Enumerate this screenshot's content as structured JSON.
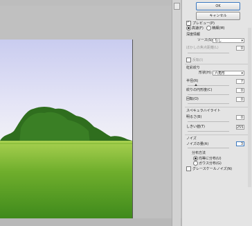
{
  "buttons": {
    "ok": "OK",
    "cancel": "キャンセル"
  },
  "preview": {
    "label": "プレビュー(P)",
    "checked": true
  },
  "modes": {
    "fast": "高速(F)",
    "accurate": "精細(M)",
    "selected": "fast"
  },
  "depth_map": {
    "heading": "深度情報",
    "source_label": "ソース(S):",
    "source_value": "なし",
    "focus_label": "ぼかしの焦点距離(L)",
    "focus_value": "0",
    "invert_label": "反転(I)"
  },
  "iris": {
    "heading": "虹彩絞り",
    "shape_label": "形状(H):",
    "shape_value": "六角形",
    "radius_label": "半径(R)",
    "radius_value": "7",
    "curvature_label": "絞りの円形度(C)",
    "curvature_value": "0",
    "rotation_label": "回転(O)",
    "rotation_value": "0"
  },
  "specular": {
    "heading": "スペキュラハイライト",
    "brightness_label": "明るさ(B)",
    "brightness_value": "0",
    "threshold_label": "しきい値(T)",
    "threshold_value": "255"
  },
  "noise": {
    "heading": "ノイズ",
    "amount_label": "ノイズの量(A)",
    "amount_value": "3",
    "distribution_heading": "分布方法",
    "uniform_label": "均等に分布(U)",
    "gaussian_label": "ガウス分布(G)",
    "distribution_selected": "uniform",
    "monochrome_label": "グレースケールノイズ(N)",
    "monochrome_checked": false
  }
}
